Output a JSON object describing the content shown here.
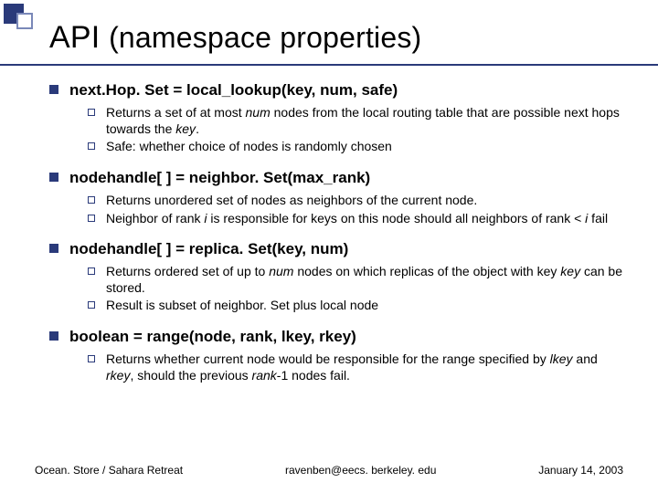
{
  "title_main": "API ",
  "title_paren": "(namespace properties)",
  "blocks": [
    {
      "heading": "next.Hop. Set = local_lookup(key, num, safe)",
      "subs": [
        {
          "pre": "Returns a set of at most ",
          "em1": "num",
          "mid": " nodes from the local routing table that are possible next hops towards the ",
          "em2": "key",
          "post": "."
        },
        {
          "pre": "Safe: whether choice of nodes is randomly chosen"
        }
      ]
    },
    {
      "heading": "nodehandle[ ] = neighbor. Set(max_rank)",
      "subs": [
        {
          "pre": "Returns unordered set of nodes as neighbors of the current node."
        },
        {
          "pre": "Neighbor of rank ",
          "em1": "i",
          "mid": " is responsible for keys on this node should all neighbors of rank < ",
          "em2": "i",
          "post": "  fail"
        }
      ]
    },
    {
      "heading": "nodehandle[ ] = replica. Set(key, num)",
      "subs": [
        {
          "pre": "Returns ordered set of up to ",
          "em1": "num",
          "mid": " nodes on which replicas of the object with key ",
          "em2": "key",
          "post": " can be stored."
        },
        {
          "pre": "Result is subset of neighbor. Set plus local node"
        }
      ]
    },
    {
      "heading": "boolean = range(node, rank, lkey, rkey)",
      "subs": [
        {
          "pre": "Returns whether current node would be responsible for the range specified by ",
          "em1": "lkey",
          "mid": " and ",
          "em2": "rkey",
          "post_pre": ", should the previous ",
          "em3": "rank",
          "post": "-1 nodes fail."
        }
      ]
    }
  ],
  "footer": {
    "left": "Ocean. Store / Sahara Retreat",
    "center": "ravenben@eecs. berkeley. edu",
    "right": "January 14, 2003"
  }
}
